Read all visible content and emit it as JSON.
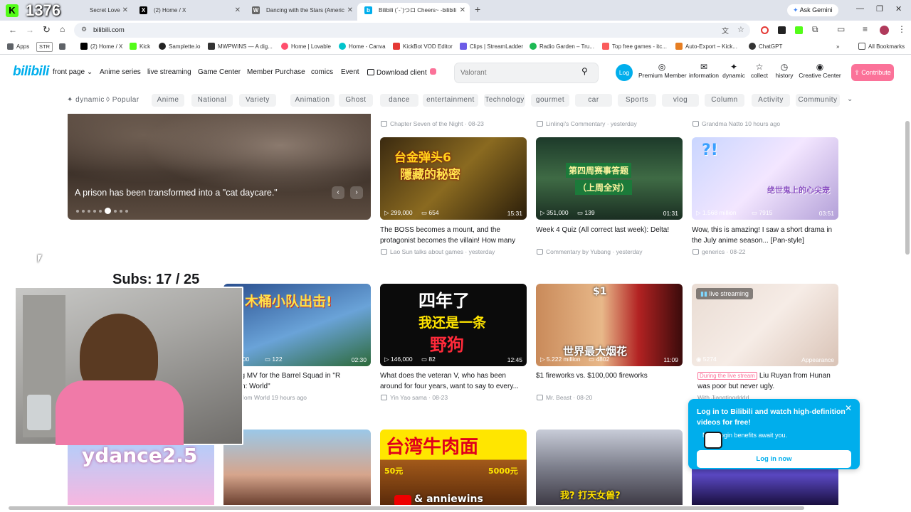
{
  "stream": {
    "counter": "1376",
    "subs": "Subs: 17 / 25"
  },
  "tabs": [
    {
      "label": "Secret Love",
      "fav": "",
      "color": "#e53935"
    },
    {
      "label": "(2) Home / X",
      "fav": "X",
      "color": "#000000"
    },
    {
      "label": "Dancing with the Stars (Americ",
      "fav": "W",
      "color": "#555555"
    },
    {
      "label": "Bilibili (´-`)つロ Cheers~ -bilibili",
      "fav": "b",
      "color": "#00aeec"
    }
  ],
  "browser": {
    "url": "bilibili.com",
    "ask_gemini": "Ask Gemini",
    "new_tab": "+"
  },
  "bookmarks": [
    {
      "label": "Apps",
      "color": "#5f6368"
    },
    {
      "label": "STR",
      "color": "#ffffff"
    },
    {
      "label": "",
      "color": "#5f6368"
    },
    {
      "label": "(2) Home / X",
      "color": "#000000"
    },
    {
      "label": "Kick",
      "color": "#53fc18"
    },
    {
      "label": "Samplette.io",
      "color": "#222222"
    },
    {
      "label": "MWPWINS — A dig...",
      "color": "#333333"
    },
    {
      "label": "Home | Lovable",
      "color": "#ff4f6d"
    },
    {
      "label": "Home - Canva",
      "color": "#00c4cc"
    },
    {
      "label": "KickBot VOD Editor",
      "color": "#e53935"
    },
    {
      "label": "Clips | StreamLadder",
      "color": "#6c5ce7"
    },
    {
      "label": "Radio Garden – Tru...",
      "color": "#1db954"
    },
    {
      "label": "Top free games - itc...",
      "color": "#fa5c5c"
    },
    {
      "label": "Auto-Export – Kick...",
      "color": "#e67e22"
    },
    {
      "label": "ChatGPT",
      "color": "#333333"
    }
  ],
  "all_bookmarks": "All Bookmarks",
  "header": {
    "logo": "bilibili",
    "nav": [
      "front page ⌄",
      "Anime series",
      "live streaming",
      "Game Center",
      "Member Purchase",
      "comics",
      "Event",
      "Download client"
    ],
    "search_placeholder": "Valorant",
    "avatar": "Log",
    "icons": [
      {
        "label": "Premium Member",
        "glyph": "◎"
      },
      {
        "label": "information",
        "glyph": "✉"
      },
      {
        "label": "dynamic",
        "glyph": "✦"
      },
      {
        "label": "collect",
        "glyph": "☆"
      },
      {
        "label": "history",
        "glyph": "◷"
      },
      {
        "label": "Creative Center",
        "glyph": "◉"
      }
    ],
    "contribute": "Contribute"
  },
  "channels": {
    "dynamic": "dynamic",
    "popular": "Popular",
    "items": [
      "Anime",
      "National",
      "Variety",
      "Animation",
      "Ghost",
      "dance",
      "entertainment",
      "Technology",
      "gourmet",
      "car",
      "Sports",
      "vlog",
      "Column",
      "Activity",
      "Community"
    ]
  },
  "banner": {
    "caption": "A prison has been transformed into a \"cat daycare.\""
  },
  "top_meta": [
    {
      "text": "Chapter Seven of the Night · 08-23"
    },
    {
      "text": "Linlinqi's Commentary · yesterday"
    },
    {
      "text": "Grandma Natto 10 hours ago"
    }
  ],
  "row1": [
    {
      "views": "299,000",
      "danmaku": "654",
      "duration": "15:31",
      "title": "The BOSS becomes a mount, and the protagonist becomes the villain! How many ...",
      "meta": "Lao Sun talks about games · yesterday",
      "overlay": "隱藏的秘密",
      "overlay_top": "台金弹头6"
    },
    {
      "views": "351,000",
      "danmaku": "139",
      "duration": "01:31",
      "title": "Week 4 Quiz (All correct last week): Delta!",
      "meta": "Commentary by Yubang · yesterday",
      "overlay": "第四周赛事答题",
      "overlay_top": "（上周全对）"
    },
    {
      "views": "1.568 million",
      "danmaku": "7915",
      "duration": "03:51",
      "title": "Wow, this is amazing! I saw a short drama in the July anime season... [Pan-style]",
      "meta": "generics · 08-22",
      "overlay": "绝世鬼上的心尖宠",
      "overlay_top": "?!"
    }
  ],
  "row2": [
    {
      "views": "5,000",
      "danmaku": "122",
      "duration": "02:30",
      "title": "e song MV for the Barrel Squad in \"R ngdom: World\"",
      "meta": "o Kingdom World 19 hours ago",
      "overlay": "木桶小队出击!"
    },
    {
      "views": "146,000",
      "danmaku": "82",
      "duration": "12:45",
      "title": "What does the veteran V, who has been around for four years, want to say to every...",
      "meta": "Yin Yao sama · 08-23",
      "overlay": "四年了",
      "overlay_2": "我还是一条",
      "overlay_3": "野狗"
    },
    {
      "views": "5.222 million",
      "danmaku": "4802",
      "duration": "11:09",
      "title": "$1 fireworks vs. $100,000 fireworks",
      "meta": "Mr. Beast · 08-20",
      "overlay": "世界最大烟花",
      "overlay_top": "$1"
    },
    {
      "views": "5274",
      "badge": "live streaming",
      "duration": "Appearance",
      "title": "Liu Ruyan from Hunan was poor but never ugly.",
      "tag": "During the live stream",
      "meta": "With Jiangtingdddd"
    }
  ],
  "row3": [
    {
      "overlay": "ydance2.5"
    },
    {
      "overlay": ""
    },
    {
      "overlay": "台湾牛肉面",
      "price1": "50元",
      "price2": "5000元",
      "brand": "& anniewins"
    },
    {
      "overlay": "我? 打天女兽?"
    }
  ],
  "login_popup": {
    "title": "Log in to Bilibili and watch high-definition videos for free!",
    "sub": "More login benefits await you.",
    "button": "Log in now"
  },
  "colors": {
    "pink": "#fb7299",
    "blue": "#00aeec",
    "bg": "#ffffff",
    "popup": "#00aeec"
  }
}
